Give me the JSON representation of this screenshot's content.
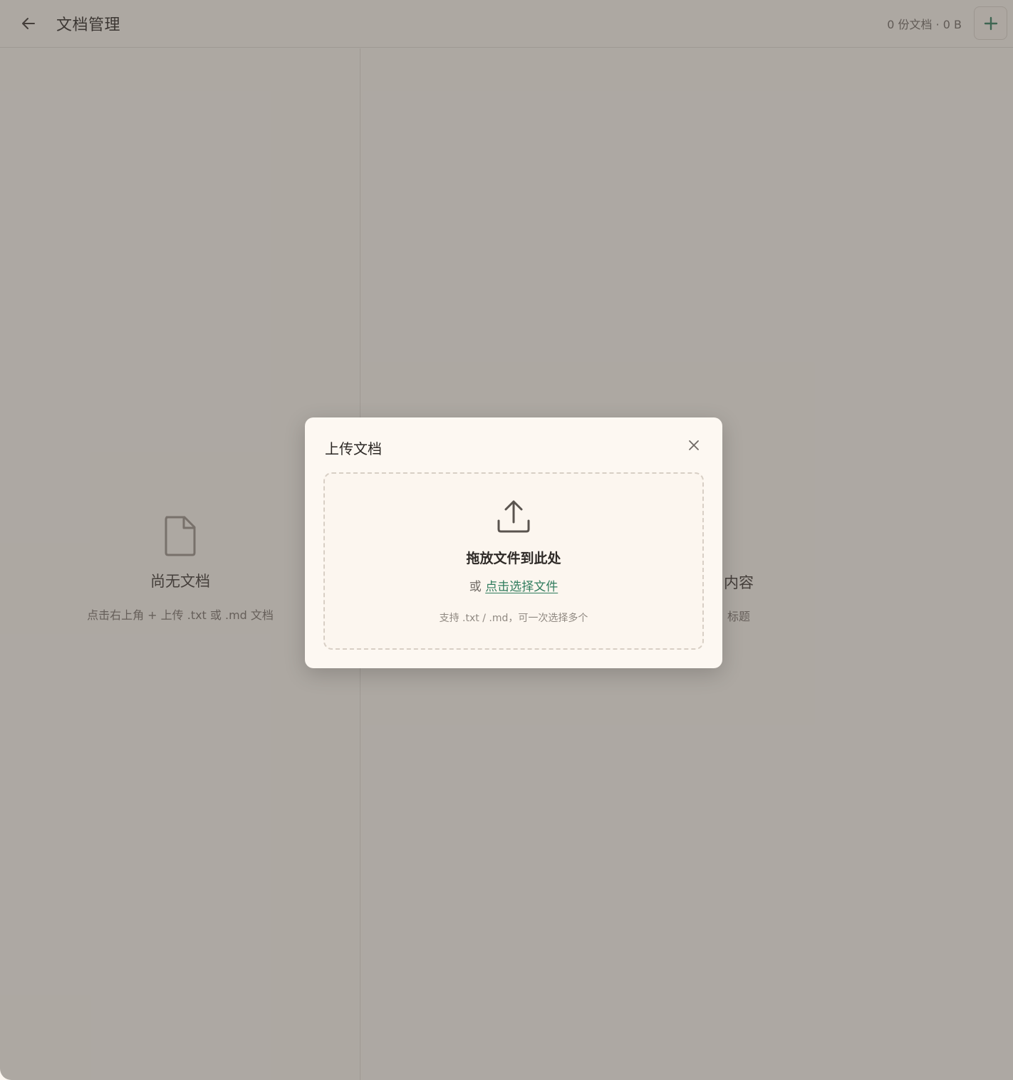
{
  "header": {
    "title": "文档管理",
    "stats": "0 份文档 · 0 B"
  },
  "left_empty": {
    "title": "尚无文档",
    "hint": "点击右上角 + 上传 .txt 或 .md 文档"
  },
  "right_empty": {
    "title_partial": "内容",
    "hint_partial": "标题"
  },
  "modal": {
    "title": "上传文档",
    "dropzone": {
      "title": "拖放文件到此处",
      "or_prefix": "或",
      "choose_link": "点击选择文件",
      "hint": "支持 .txt / .md，可一次选择多个"
    }
  },
  "colors": {
    "accent": "#2f7c5d",
    "background": "#fcf7f1",
    "overlay": "rgba(80,74,70,0.46)"
  },
  "icons": {
    "back": "arrow-left-icon",
    "add": "plus-icon",
    "document": "document-icon",
    "close": "close-icon",
    "upload": "upload-icon"
  }
}
